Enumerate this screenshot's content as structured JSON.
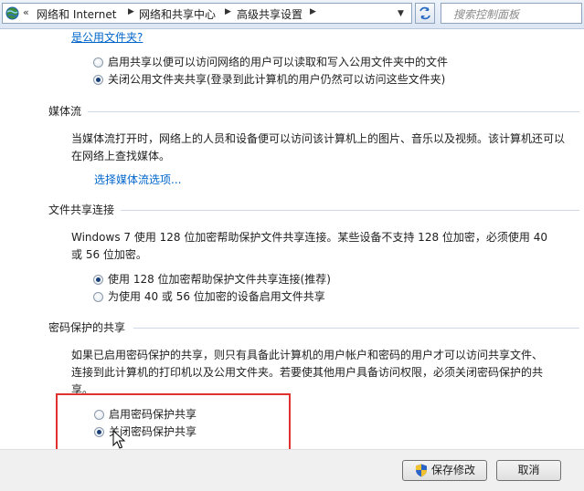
{
  "address_bar": {
    "chevron": "«",
    "crumbs": [
      "网络和 Internet",
      "网络和共享中心",
      "高级共享设置"
    ],
    "search_placeholder": "搜索控制面板"
  },
  "public_folder": {
    "link": "是公用文件夹?",
    "options": [
      {
        "label": "启用共享以便可以访问网络的用户可以读取和写入公用文件夹中的文件",
        "selected": false
      },
      {
        "label": "关闭公用文件夹共享(登录到此计算机的用户仍然可以访问这些文件夹)",
        "selected": true
      }
    ]
  },
  "media_streaming": {
    "heading": "媒体流",
    "description": "当媒体流打开时，网络上的人员和设备便可以访问该计算机上的图片、音乐以及视频。该计算机还可以在网络上查找媒体。",
    "link": "选择媒体流选项..."
  },
  "file_sharing": {
    "heading": "文件共享连接",
    "description": "Windows 7 使用 128 位加密帮助保护文件共享连接。某些设备不支持 128 位加密，必须使用 40 或 56 位加密。",
    "options": [
      {
        "label": "使用 128 位加密帮助保护文件共享连接(推荐)",
        "selected": true
      },
      {
        "label": "为使用 40 或 56 位加密的设备启用文件共享",
        "selected": false
      }
    ]
  },
  "password_protection": {
    "heading": "密码保护的共享",
    "description": "如果已启用密码保护的共享，则只有具备此计算机的用户帐户和密码的用户才可以访问共享文件、连接到此计算机的打印机以及公用文件夹。若要使其他用户具备访问权限，必须关闭密码保护的共享。",
    "options": [
      {
        "label": "启用密码保护共享",
        "selected": false
      },
      {
        "label": "关闭密码保护共享",
        "selected": true
      }
    ]
  },
  "footer": {
    "save_label": "保存修改",
    "cancel_label": "取消"
  },
  "colors": {
    "link": "#0066cc",
    "highlight_box": "#e0312f"
  },
  "icons": [
    "network-icon",
    "refresh-icon",
    "search-icon",
    "uac-shield-icon",
    "mouse-pointer-icon"
  ]
}
